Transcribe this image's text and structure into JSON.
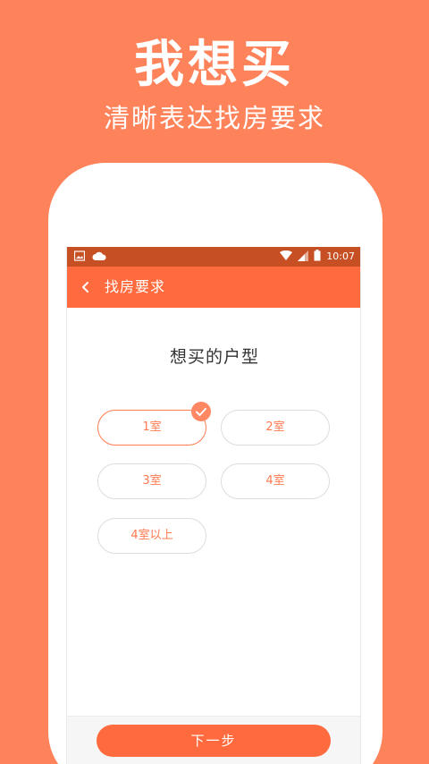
{
  "promo": {
    "title": "我想买",
    "subtitle": "清晰表达找房要求"
  },
  "status_bar": {
    "time": "10:07",
    "icons": [
      "image-icon",
      "cloud-icon",
      "wifi-icon",
      "signal-icon",
      "battery-icon"
    ]
  },
  "app_bar": {
    "title": "找房要求",
    "back_icon": "chevron-left-icon"
  },
  "question": "想买的户型",
  "options": [
    {
      "label": "1室",
      "selected": true
    },
    {
      "label": "2室",
      "selected": false
    },
    {
      "label": "3室",
      "selected": false
    },
    {
      "label": "4室",
      "selected": false
    },
    {
      "label": "4室以上",
      "selected": false
    }
  ],
  "next_button": "下一步",
  "colors": {
    "background": "#FF835A",
    "status_bar": "#C65023",
    "app_bar": "#FF6B3E",
    "accent": "#FF7A4F"
  }
}
